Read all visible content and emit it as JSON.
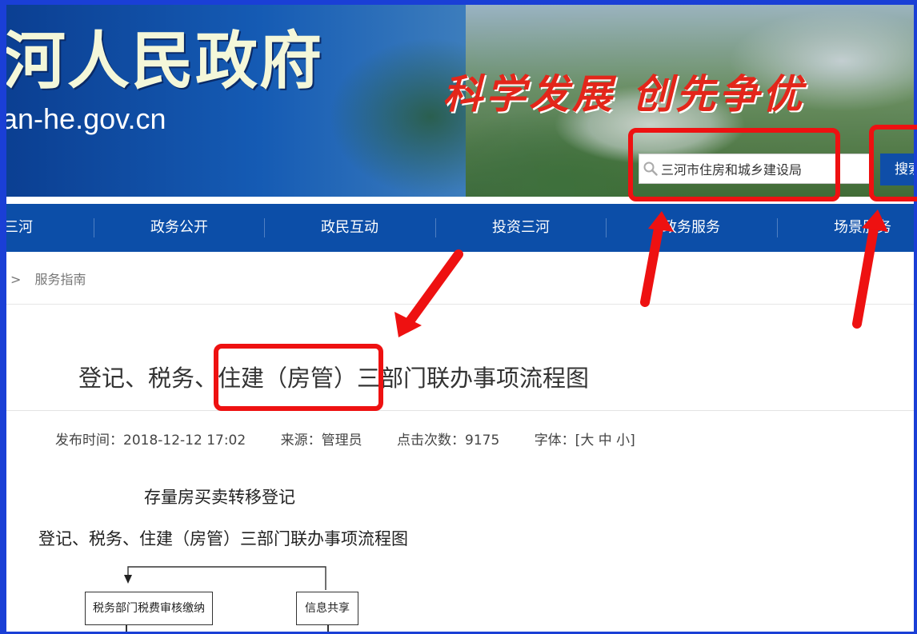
{
  "banner": {
    "site_title": "河人民政府",
    "site_url": "an-he.gov.cn",
    "slogan": "科学发展  创先争优"
  },
  "search": {
    "value": "三河市住房和城乡建设局",
    "button_label": "搜索"
  },
  "nav": {
    "items": [
      "三河",
      "政务公开",
      "政民互动",
      "投资三河",
      "政务服务",
      "场景服务"
    ]
  },
  "breadcrumb": {
    "separator": ">",
    "current": "服务指南"
  },
  "article": {
    "title_before": "登记、税务、",
    "title_highlight": "住建（房管）",
    "title_after": "三部门联办事项流程图",
    "meta": {
      "publish_time": "发布时间：2018-12-12 17:02",
      "source": "来源：管理员",
      "clicks": "点击次数：9175",
      "font_size": "字体：[大 中 小]"
    },
    "subtitle_1": "存量房买卖转移登记",
    "subtitle_2": "登记、税务、住建（房管）三部门联办事项流程图",
    "flow": {
      "box_tax": "税务部门税费审核缴纳",
      "box_info": "信息共享"
    }
  },
  "colors": {
    "nav_bg": "#0c4ea8",
    "annotation_red": "#ee1111",
    "outer_border": "#1a3fd6"
  }
}
